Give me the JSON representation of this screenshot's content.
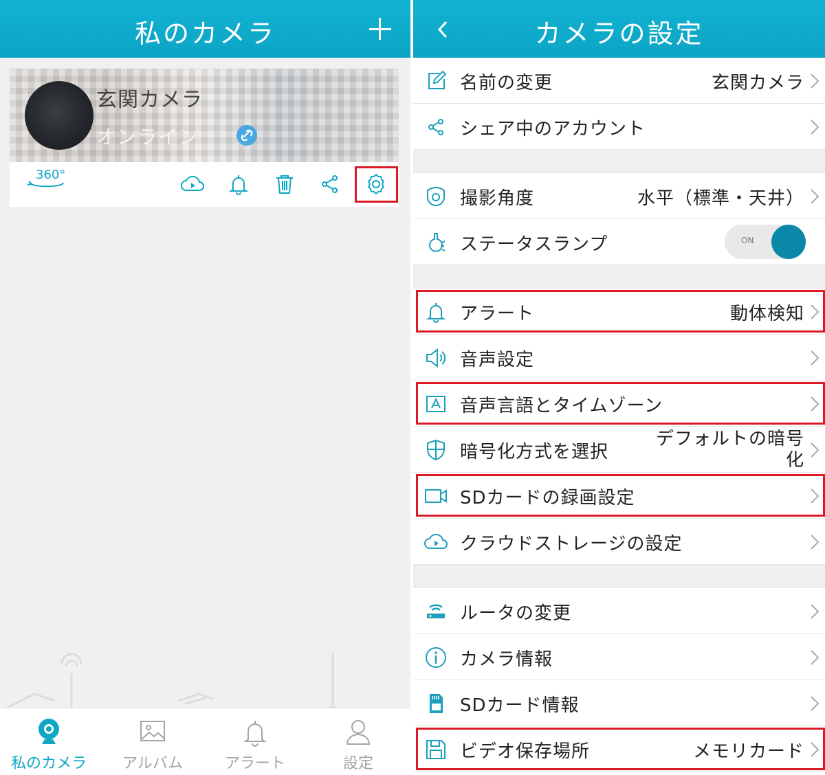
{
  "left": {
    "header": {
      "title": "私のカメラ",
      "add_icon": "plus-icon"
    },
    "camera_card": {
      "name": "玄関カメラ",
      "status": "オンライン",
      "panorama_label": "360°",
      "actions": [
        "cloud-play-icon",
        "bell-icon",
        "trash-icon",
        "share-icon",
        "gear-icon"
      ],
      "highlighted_action": "gear-icon"
    },
    "bottom_nav": [
      {
        "label": "私のカメラ",
        "icon": "camera-icon",
        "active": true
      },
      {
        "label": "アルバム",
        "icon": "image-icon",
        "active": false
      },
      {
        "label": "アラート",
        "icon": "bell-icon",
        "active": false
      },
      {
        "label": "設定",
        "icon": "person-icon",
        "active": false
      }
    ]
  },
  "right": {
    "header": {
      "title": "カメラの設定",
      "back_icon": "chevron-left-icon"
    },
    "rows": [
      {
        "label": "名前の変更",
        "value": "玄関カメラ",
        "icon": "edit-icon"
      },
      {
        "label": "シェア中のアカウント",
        "value": "",
        "icon": "share-icon"
      },
      {
        "label": "撮影角度",
        "value": "水平（標準・天井）",
        "icon": "camera-angle-icon"
      },
      {
        "label": "ステータスランプ",
        "toggle_text": "ON",
        "toggle_on": true,
        "icon": "lamp-icon"
      },
      {
        "label": "アラート",
        "value": "動体検知",
        "icon": "bell-icon",
        "highlighted": true
      },
      {
        "label": "音声設定",
        "value": "",
        "icon": "speaker-icon"
      },
      {
        "label": "音声言語とタイムゾーン",
        "value": "",
        "icon": "language-icon",
        "highlighted": true
      },
      {
        "label": "暗号化方式を選択",
        "value": "デフォルトの暗号化",
        "icon": "shield-icon"
      },
      {
        "label": "SDカードの録画設定",
        "value": "",
        "icon": "video-icon",
        "highlighted": true
      },
      {
        "label": "クラウドストレージの設定",
        "value": "",
        "icon": "cloud-play-icon"
      },
      {
        "label": "ルータの変更",
        "value": "",
        "icon": "router-icon"
      },
      {
        "label": "カメラ情報",
        "value": "",
        "icon": "info-icon"
      },
      {
        "label": "SDカード情報",
        "value": "",
        "icon": "sd-card-icon"
      },
      {
        "label": "ビデオ保存場所",
        "value": "メモリカード",
        "icon": "floppy-icon",
        "highlighted": true
      }
    ]
  },
  "colors": {
    "accent": "#0ea7c5",
    "highlight": "#d91a24",
    "toggle_knob": "#0b88a8"
  }
}
